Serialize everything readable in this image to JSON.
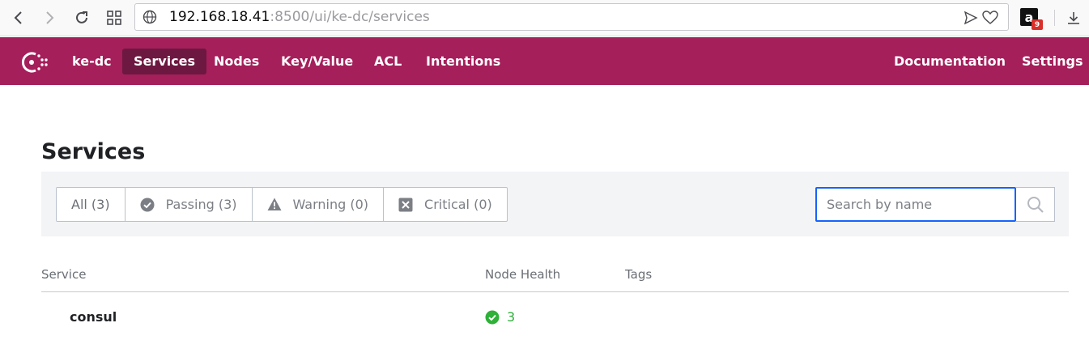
{
  "browser": {
    "url_host": "192.168.18.41",
    "url_rest": ":8500/ui/ke-dc/services",
    "extension_badge": "9",
    "extension_letter": "a"
  },
  "header": {
    "datacenter": "ke-dc",
    "nav": [
      "Services",
      "Nodes",
      "Key/Value",
      "ACL",
      "Intentions"
    ],
    "active": "Services",
    "right_nav": [
      "Documentation",
      "Settings"
    ]
  },
  "page": {
    "title": "Services"
  },
  "filters": {
    "all": "All (3)",
    "passing": "Passing (3)",
    "warning": "Warning (0)",
    "critical": "Critical (0)"
  },
  "search": {
    "placeholder": "Search by name",
    "value": ""
  },
  "table": {
    "columns": [
      "Service",
      "Node Health",
      "Tags"
    ],
    "rows": [
      {
        "service": "consul",
        "health": "3",
        "tags": ""
      }
    ]
  },
  "colors": {
    "brand": "#a51f5b",
    "active_nav": "#6d1840",
    "passing": "#2eb039",
    "focus": "#1563ff"
  }
}
